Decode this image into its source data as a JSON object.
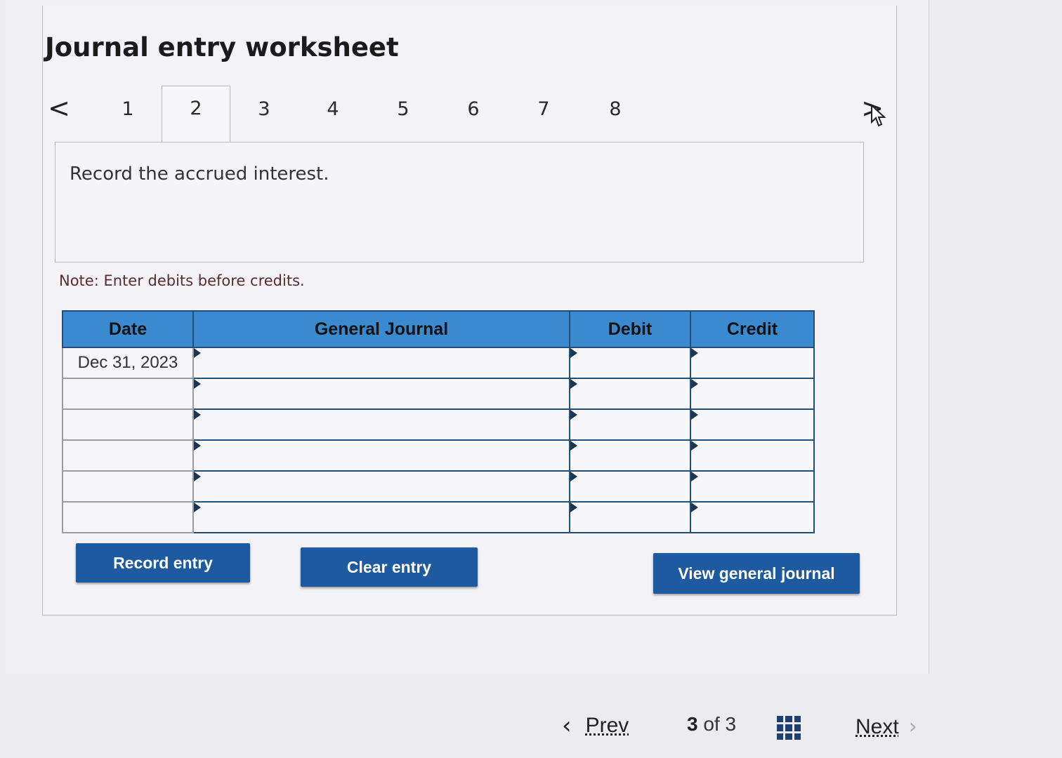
{
  "worksheet": {
    "title": "Journal entry worksheet",
    "tabs": [
      "1",
      "2",
      "3",
      "4",
      "5",
      "6",
      "7",
      "8"
    ],
    "active_tab": "2",
    "prev_arrow": "<",
    "next_arrow": ">"
  },
  "prompt": {
    "text": "Record the accrued interest."
  },
  "note": "Note: Enter debits before credits.",
  "journal": {
    "headers": {
      "date": "Date",
      "general_journal": "General Journal",
      "debit": "Debit",
      "credit": "Credit"
    },
    "rows": [
      {
        "date": "Dec 31, 2023",
        "account": "",
        "debit": "",
        "credit": ""
      },
      {
        "date": "",
        "account": "",
        "debit": "",
        "credit": ""
      },
      {
        "date": "",
        "account": "",
        "debit": "",
        "credit": ""
      },
      {
        "date": "",
        "account": "",
        "debit": "",
        "credit": ""
      },
      {
        "date": "",
        "account": "",
        "debit": "",
        "credit": ""
      },
      {
        "date": "",
        "account": "",
        "debit": "",
        "credit": ""
      }
    ]
  },
  "buttons": {
    "record": "Record entry",
    "clear": "Clear entry",
    "view_journal": "View general journal"
  },
  "footer": {
    "prev": "Prev",
    "next": "Next",
    "current_page": "3",
    "of_label": "of",
    "total_pages": "3"
  },
  "colors": {
    "header_blue": "#3b8ad0",
    "button_blue": "#1e5aa0",
    "grid_border": "#1f4f78"
  },
  "icons": [
    "chevron-left-icon",
    "chevron-right-icon",
    "grid-menu-icon",
    "mouse-cursor-icon"
  ]
}
